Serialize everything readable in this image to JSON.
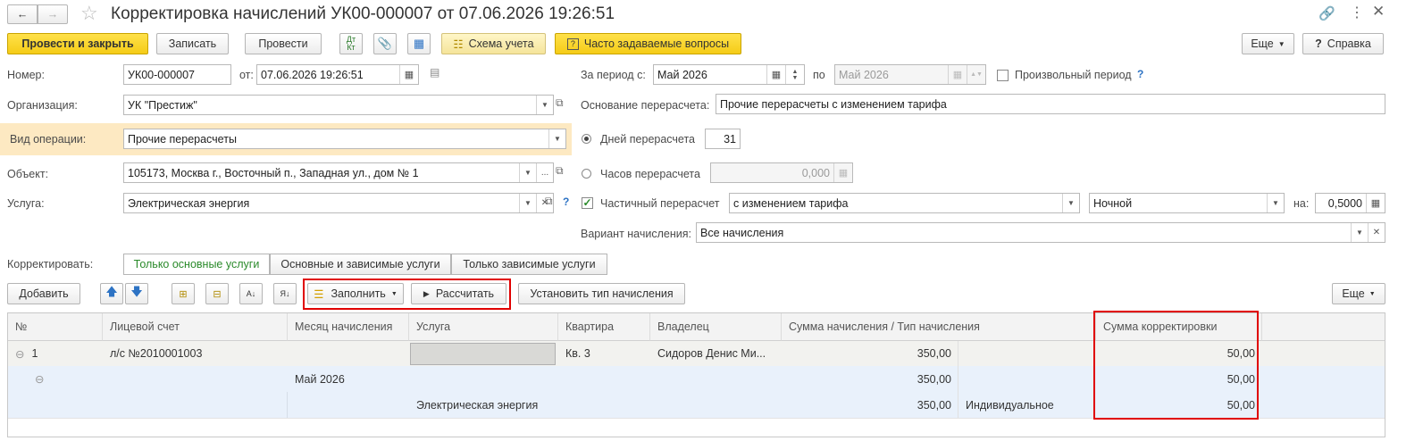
{
  "title": "Корректировка начислений УК00-000007 от 07.06.2026 19:26:51",
  "toolbar": {
    "post_close": "Провести и закрыть",
    "save": "Записать",
    "post": "Провести",
    "dtkt": "ДтКт",
    "scheme": "Схема учета",
    "faq": "Часто задаваемые вопросы",
    "more": "Еще",
    "help": "Справка"
  },
  "form": {
    "number_label": "Номер:",
    "number": "УК00-000007",
    "from_label": "от:",
    "date": "07.06.2026 19:26:51",
    "org_label": "Организация:",
    "org": "УК \"Престиж\"",
    "optype_label": "Вид операции:",
    "optype": "Прочие перерасчеты",
    "object_label": "Объект:",
    "object": "105173, Москва г., Восточный п., Западная ул., дом № 1",
    "service_label": "Услуга:",
    "service": "Электрическая энергия",
    "period_label": "За период с:",
    "period_from": "Май 2026",
    "period_to_label": "по",
    "period_to": "Май 2026",
    "arbitrary_period": "Произвольный период",
    "reason_label": "Основание перерасчета:",
    "reason": "Прочие перерасчеты с изменением тарифа",
    "days_label": "Дней перерасчета",
    "days": "31",
    "hours_label": "Часов перерасчета",
    "hours": "0,000",
    "partial_label": "Частичный перерасчет",
    "partial_type": "с изменением тарифа",
    "zone": "Ночной",
    "on_label": "на:",
    "coef": "0,5000",
    "variant_label": "Вариант начисления:",
    "variant": "Все начисления",
    "correct_label": "Корректировать:",
    "tabs": [
      "Только основные услуги",
      "Основные и зависимые услуги",
      "Только зависимые услуги"
    ]
  },
  "tabletoolbar": {
    "add": "Добавить",
    "fill": "Заполнить",
    "calc": "Рассчитать",
    "settype": "Установить тип начисления",
    "more": "Еще"
  },
  "table": {
    "headers": [
      "№",
      "Лицевой счет",
      "Месяц начисления",
      "Услуга",
      "Квартира",
      "Владелец",
      "Сумма начисления / Тип начисления",
      "Сумма корректировки"
    ],
    "rows": [
      {
        "num": "1",
        "account": "л/с №2010001003",
        "month": "",
        "service": "",
        "apt": "Кв. 3",
        "owner": "Сидоров Денис Ми...",
        "sum": "350,00",
        "type": "",
        "corr": "50,00"
      },
      {
        "num": "",
        "account": "",
        "month": "Май 2026",
        "service": "",
        "apt": "",
        "owner": "",
        "sum": "350,00",
        "type": "",
        "corr": "50,00"
      },
      {
        "num": "",
        "account": "",
        "month": "",
        "service": "Электрическая энергия",
        "apt": "",
        "owner": "",
        "sum": "350,00",
        "type": "Индивидуальное",
        "corr": "50,00"
      }
    ]
  }
}
